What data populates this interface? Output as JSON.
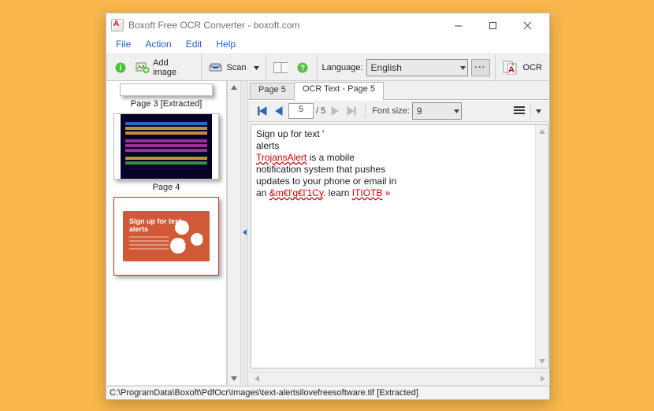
{
  "window": {
    "title": "Boxoft Free OCR Converter - boxoft.com",
    "min_icon": "minimize-icon",
    "max_icon": "maximize-icon",
    "close_icon": "close-icon"
  },
  "menu": {
    "file": "File",
    "action": "Action",
    "edit": "Edit",
    "help": "Help"
  },
  "toolbar": {
    "add_image_label": "Add image",
    "scan_label": "Scan",
    "language_label": "Language:",
    "language_value": "English",
    "ocr_label": "OCR"
  },
  "thumbs": {
    "page3_caption": "Page 3 [Extracted]",
    "page4_caption": "Page 4",
    "page5_t1": "Sign up for text",
    "page5_t2": "alerts"
  },
  "tabs": {
    "tab1": "Page 5",
    "tab2": "OCR Text - Page 5"
  },
  "subtb": {
    "page_field": "5",
    "page_total": "/  5",
    "font_size_label": "Font size:",
    "font_size_value": "9"
  },
  "ocr": {
    "l1": "Sign up for text '",
    "l2": "alerts",
    "l3a": "TrojansAlert",
    "l3b": " is a mobile",
    "l4": "notification system that pushes",
    "l5": "updates to your phone or email in",
    "l6a": "an ",
    "l6b": "&m€l'g€l'1Cy",
    "l6c": ". learn ",
    "l6d": "ITIOTB",
    "l6e": " »"
  },
  "status": {
    "text": "C:\\ProgramData\\Boxoft\\PdfOcr\\Images\\text-alertsilovefreesoftware.tif [Extracted]"
  }
}
